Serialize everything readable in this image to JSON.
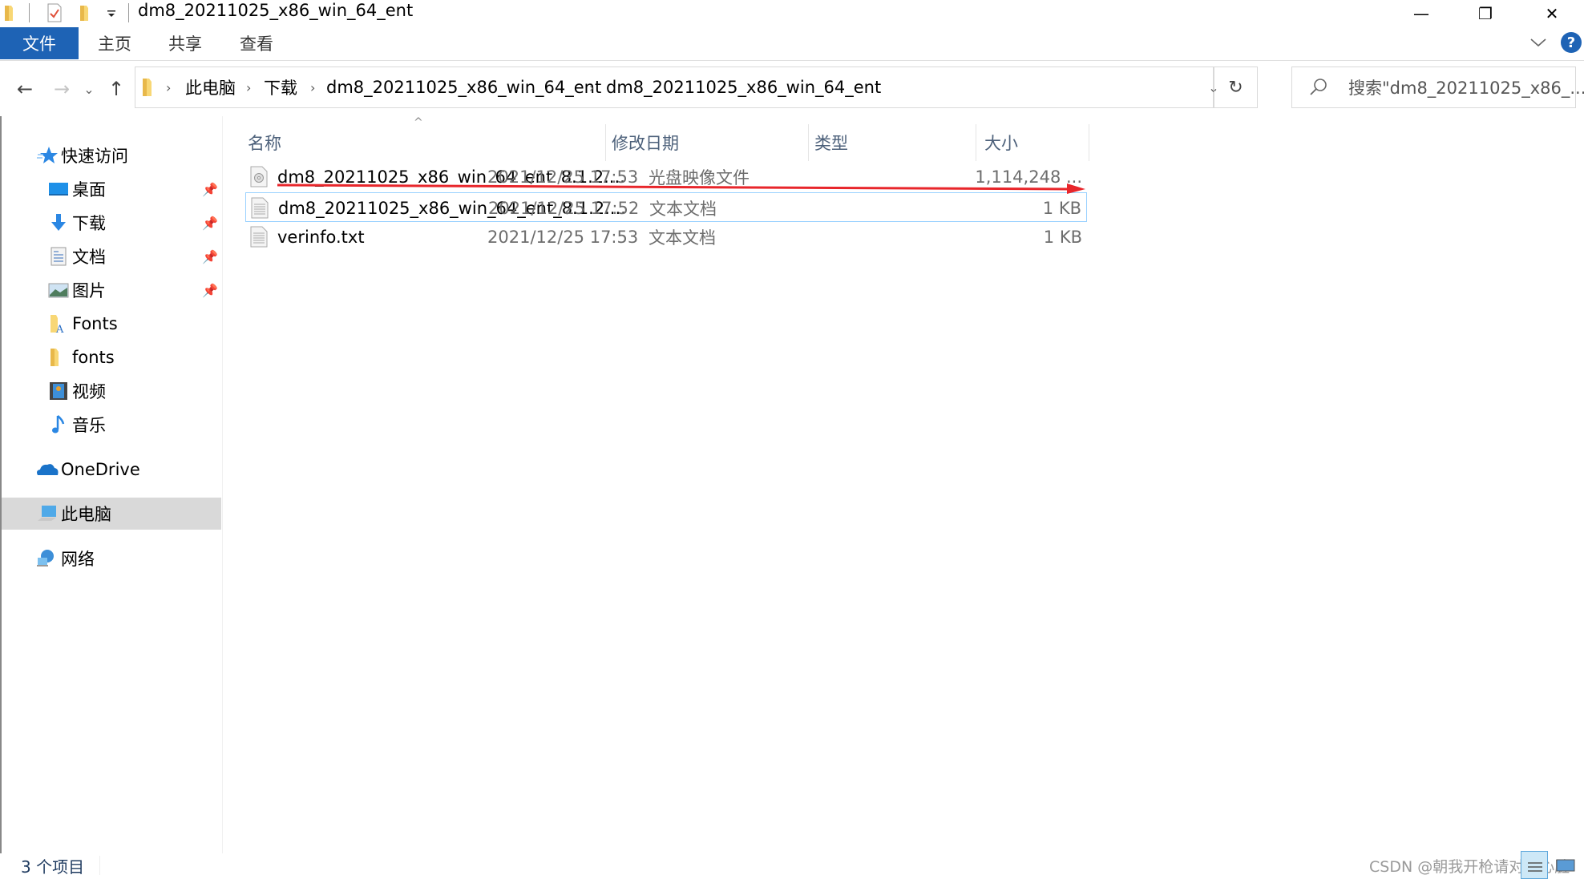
{
  "window": {
    "title": "dm8_20211025_x86_win_64_ent",
    "controls": {
      "minimize": "—",
      "restore": "❐",
      "close": "✕"
    },
    "quick_access_icons": [
      "folder-icon",
      "properties-icon",
      "new-folder-icon",
      "customize-dropdown-icon"
    ]
  },
  "ribbon": {
    "tabs": [
      {
        "label": "文件",
        "active": true
      },
      {
        "label": "主页"
      },
      {
        "label": "共享"
      },
      {
        "label": "查看"
      }
    ],
    "expand_icon": "chevron-down-icon",
    "help_icon": "help-icon",
    "help_glyph": "?",
    "accent_color": "#1e63b5"
  },
  "address_bar": {
    "back": "←",
    "forward": "→",
    "recent": "⌄",
    "up": "↑",
    "breadcrumbs": [
      "此电脑",
      "下载",
      "dm8_20211025_x86_win_64_ent",
      "dm8_20211025_x86_win_64_ent"
    ],
    "separator": "›",
    "dropdown": "⌄",
    "refresh": "↻"
  },
  "search": {
    "placeholder": "搜索\"dm8_20211025_x86_..."
  },
  "nav_pane": {
    "quick_access": {
      "label": "快速访问",
      "icon": "star-icon"
    },
    "items": [
      {
        "label": "桌面",
        "icon": "desktop-icon",
        "pinned": true
      },
      {
        "label": "下载",
        "icon": "download-icon",
        "pinned": true
      },
      {
        "label": "文档",
        "icon": "documents-icon",
        "pinned": true
      },
      {
        "label": "图片",
        "icon": "pictures-icon",
        "pinned": true
      },
      {
        "label": "Fonts",
        "icon": "fonts-folder-icon",
        "pinned": false
      },
      {
        "label": "fonts",
        "icon": "folder-icon",
        "pinned": false
      },
      {
        "label": "视频",
        "icon": "videos-icon",
        "pinned": false
      },
      {
        "label": "音乐",
        "icon": "music-icon",
        "pinned": false
      }
    ],
    "onedrive": {
      "label": "OneDrive",
      "icon": "onedrive-icon"
    },
    "this_pc": {
      "label": "此电脑",
      "icon": "computer-icon",
      "selected": true
    },
    "network": {
      "label": "网络",
      "icon": "network-icon"
    }
  },
  "file_list": {
    "columns": [
      {
        "key": "name",
        "label": "名称",
        "sorted": "ascending"
      },
      {
        "key": "date",
        "label": "修改日期"
      },
      {
        "key": "type",
        "label": "类型"
      },
      {
        "key": "size",
        "label": "大小"
      }
    ],
    "sort_glyph": "^",
    "rows": [
      {
        "name": "dm8_20211025_x86_win_64_ent_8.1.2....",
        "date": "2021/12/25 17:53",
        "type": "光盘映像文件",
        "size": "1,114,248 ...",
        "icon": "disc-image-icon",
        "focused": false
      },
      {
        "name": "dm8_20211025_x86_win_64_ent_8.1.2....",
        "date": "2021/12/25 17:52",
        "type": "文本文档",
        "size": "1 KB",
        "icon": "text-file-icon",
        "focused": true
      },
      {
        "name": "verinfo.txt",
        "date": "2021/12/25 17:53",
        "type": "文本文档",
        "size": "1 KB",
        "icon": "text-file-icon",
        "focused": false
      }
    ],
    "annotation_color": "#e8262b"
  },
  "status_bar": {
    "item_count": "3 个项目",
    "watermark": "CSDN @朝我开枪请对准心脏"
  }
}
